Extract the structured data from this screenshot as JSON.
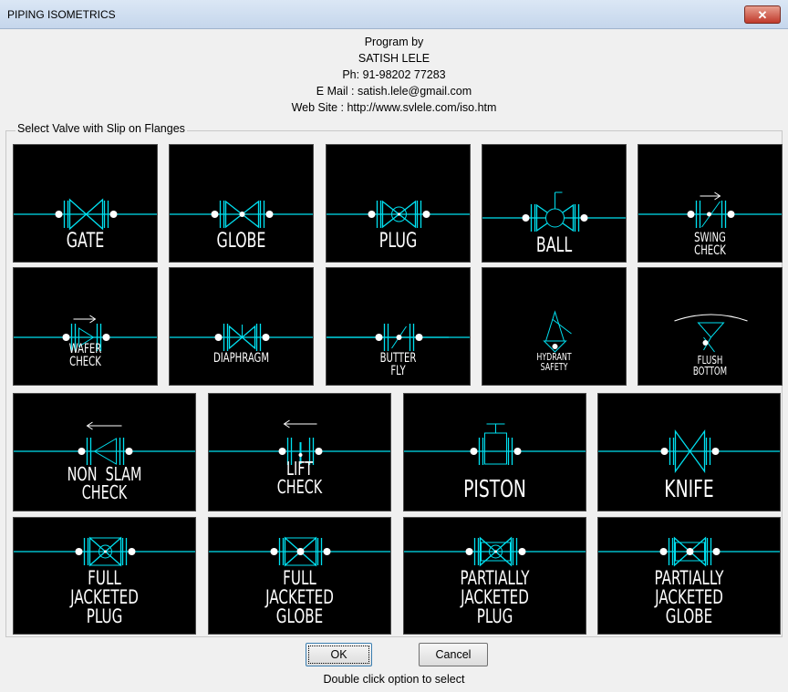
{
  "window": {
    "title": "PIPING ISOMETRICS",
    "close_label": "✕"
  },
  "credits": [
    "Program by",
    "SATISH LELE",
    "Ph: 91-98202 77283",
    "E Mail : satish.lele@gmail.com",
    "Web Site : http://www.svlele.com/iso.htm"
  ],
  "group_label": "Select Valve with Slip on Flanges",
  "options": [
    {
      "label": "GATE",
      "symbol": "gate-valve-icon"
    },
    {
      "label": "GLOBE",
      "symbol": "globe-valve-icon"
    },
    {
      "label": "PLUG",
      "symbol": "plug-valve-icon"
    },
    {
      "label": "BALL",
      "symbol": "ball-valve-icon"
    },
    {
      "label": "SWING\nCHECK",
      "symbol": "swing-check-valve-icon"
    },
    {
      "label": "WAFER\nCHECK",
      "symbol": "wafer-check-valve-icon"
    },
    {
      "label": "DIAPHRAGM",
      "symbol": "diaphragm-valve-icon"
    },
    {
      "label": "BUTTER\nFLY",
      "symbol": "butterfly-valve-icon"
    },
    {
      "label": "HYDRANT\nSAFETY",
      "symbol": "hydrant-safety-valve-icon"
    },
    {
      "label": "FLUSH\nBOTTOM",
      "symbol": "flush-bottom-valve-icon"
    },
    {
      "label": "NON  SLAM\nCHECK",
      "symbol": "non-slam-check-valve-icon"
    },
    {
      "label": "LIFT\nCHECK",
      "symbol": "lift-check-valve-icon"
    },
    {
      "label": "PISTON",
      "symbol": "piston-valve-icon"
    },
    {
      "label": "KNIFE",
      "symbol": "knife-valve-icon"
    },
    {
      "label": "FULL\nJACKETED\nPLUG",
      "symbol": "jacketed-plug-valve-icon"
    },
    {
      "label": "FULL\nJACKETED\nGLOBE",
      "symbol": "jacketed-globe-valve-icon"
    },
    {
      "label": "PARTIALLY\nJACKETED\nPLUG",
      "symbol": "partial-jacketed-plug-valve-icon"
    },
    {
      "label": "PARTIALLY\nJACKETED\nGLOBE",
      "symbol": "partial-jacketed-globe-valve-icon"
    }
  ],
  "buttons": {
    "ok": "OK",
    "cancel": "Cancel"
  },
  "status": "Double click option to select",
  "colors": {
    "line": "#00e0f0",
    "label": "#ffffff",
    "tile_bg": "#000000"
  }
}
